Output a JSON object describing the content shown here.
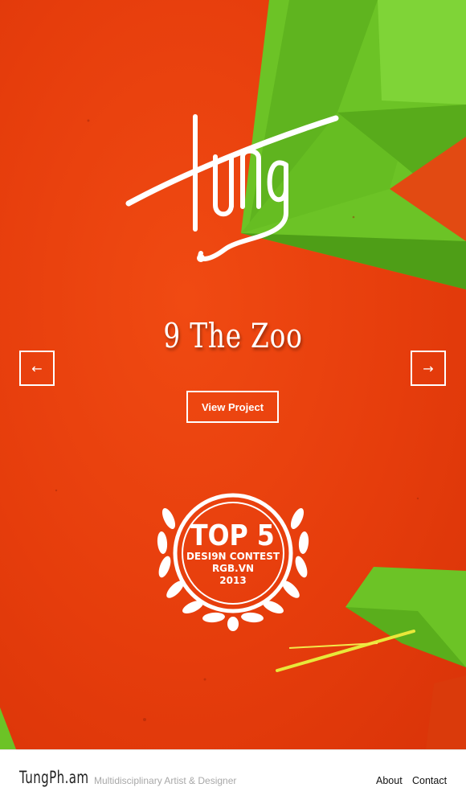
{
  "hero": {
    "project_title": "9 The Zoo",
    "view_button_label": "View Project",
    "prev_arrow": "←",
    "next_arrow": "→",
    "logo_text": "tung",
    "colors": {
      "background": "#e63d0c",
      "green": "#6cc326",
      "green_dark": "#4e9e17",
      "accent_yellow": "#e8e83a"
    }
  },
  "badge": {
    "line1": "TOP 5",
    "line2": "DESI9N CONTEST",
    "line3": "RGB.VN",
    "line4": "2013",
    "icon": "laurel-wreath-icon"
  },
  "footer": {
    "brand": "TungPh.am",
    "tagline": "Multidisciplinary Artist & Designer",
    "nav": [
      {
        "label": "About"
      },
      {
        "label": "Contact"
      }
    ]
  }
}
